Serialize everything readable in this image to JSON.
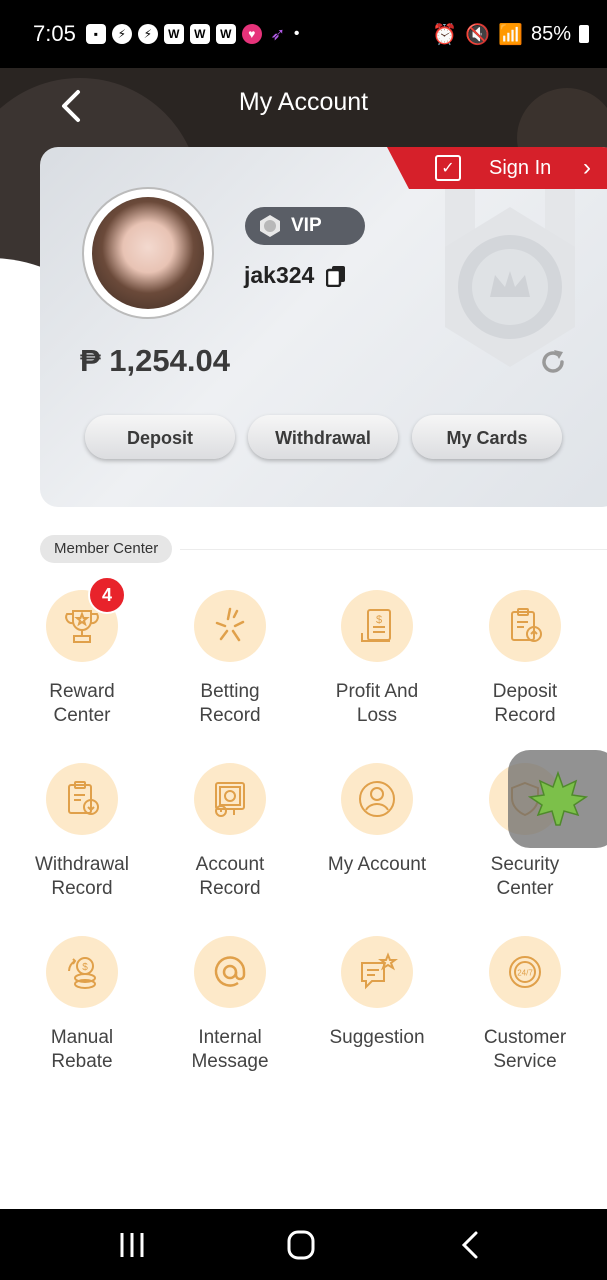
{
  "status_bar": {
    "time": "7:05",
    "battery": "85%"
  },
  "header": {
    "title": "My Account"
  },
  "card": {
    "sign_in": "Sign In",
    "vip_label": "VIP",
    "username": "jak324",
    "balance": "₱ 1,254.04",
    "buttons": {
      "deposit": "Deposit",
      "withdrawal": "Withdrawal",
      "my_cards": "My Cards"
    }
  },
  "member_center": {
    "title": "Member Center",
    "items": [
      {
        "label": "Reward\nCenter",
        "icon": "trophy-icon",
        "badge": "4"
      },
      {
        "label": "Betting\nRecord",
        "icon": "sparkle-icon"
      },
      {
        "label": "Profit And\nLoss",
        "icon": "receipt-icon"
      },
      {
        "label": "Deposit\nRecord",
        "icon": "clipboard-upload-icon"
      },
      {
        "label": "Withdrawal\nRecord",
        "icon": "clipboard-download-icon"
      },
      {
        "label": "Account\nRecord",
        "icon": "safe-icon"
      },
      {
        "label": "My Account",
        "icon": "user-icon"
      },
      {
        "label": "Security\nCenter",
        "icon": "shield-icon"
      },
      {
        "label": "Manual\nRebate",
        "icon": "coins-icon"
      },
      {
        "label": "Internal\nMessage",
        "icon": "at-icon"
      },
      {
        "label": "Suggestion",
        "icon": "chat-star-icon"
      },
      {
        "label": "Customer\nService",
        "icon": "support-24-7-icon"
      }
    ]
  },
  "colors": {
    "accent": "#d6202a",
    "icon_bg": "#fde9c9",
    "icon_stroke": "#e0a04a",
    "header_bg": "#2a2522"
  }
}
